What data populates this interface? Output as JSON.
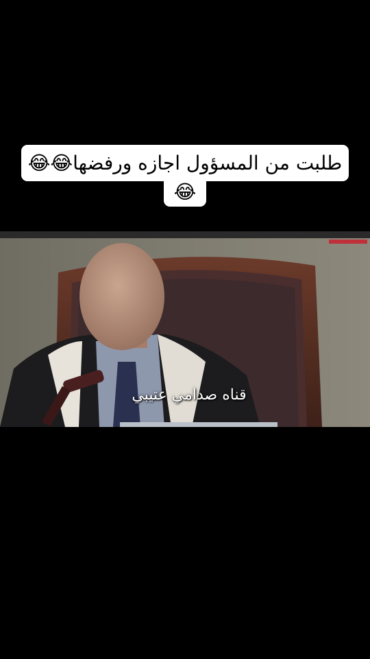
{
  "caption": {
    "line1": "طلبت من المسؤول اجازه ورفضها😂😂",
    "line2": "😂"
  },
  "video": {
    "watermark": "قناه صدامي عتيبي"
  }
}
